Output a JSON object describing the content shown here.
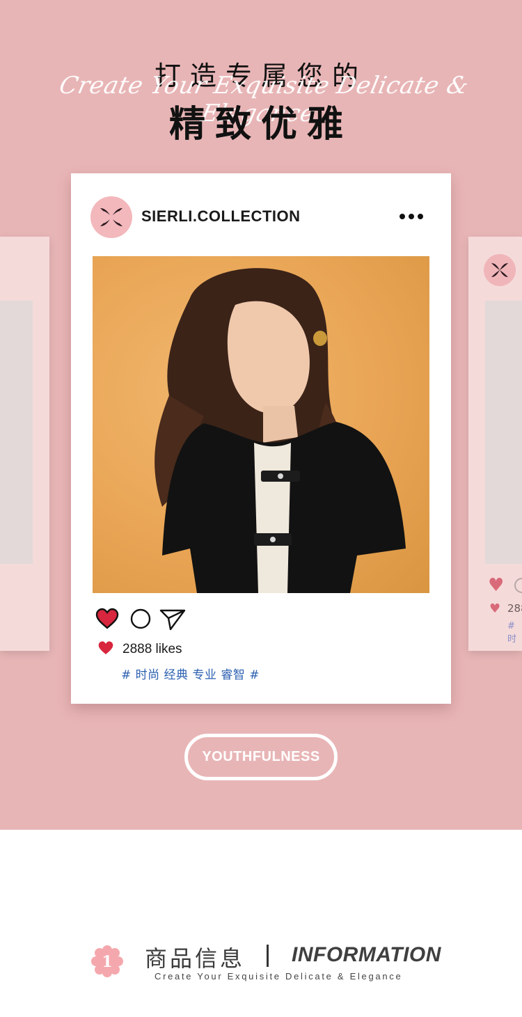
{
  "header": {
    "title_line1": "打造专属您的",
    "subtitle_en": "Create Your Exquisite Delicate & Elegance",
    "title_line2": "精致优雅"
  },
  "post": {
    "username": "SIERLI.COLLECTION",
    "more_icon": "more-dots-icon",
    "likes": "2888 likes",
    "tags": "# 时尚 经典 专业 睿智 #",
    "actions": [
      "heart-icon",
      "comment-icon",
      "share-icon"
    ],
    "like_color": "#d7263d"
  },
  "side_card_right": {
    "likes_partial": "288",
    "tag_partial": "# 时"
  },
  "pill_label": "YOUTHFULNESS",
  "info": {
    "number": "1",
    "title_cn": "商品信息",
    "title_en": "INFORMATION",
    "subtitle": "Create Your Exquisite Delicate & Elegance"
  },
  "colors": {
    "background_pink": "#e8b5b6",
    "accent_pink": "#f3b8bc",
    "tag_blue": "#2a5fb0"
  }
}
